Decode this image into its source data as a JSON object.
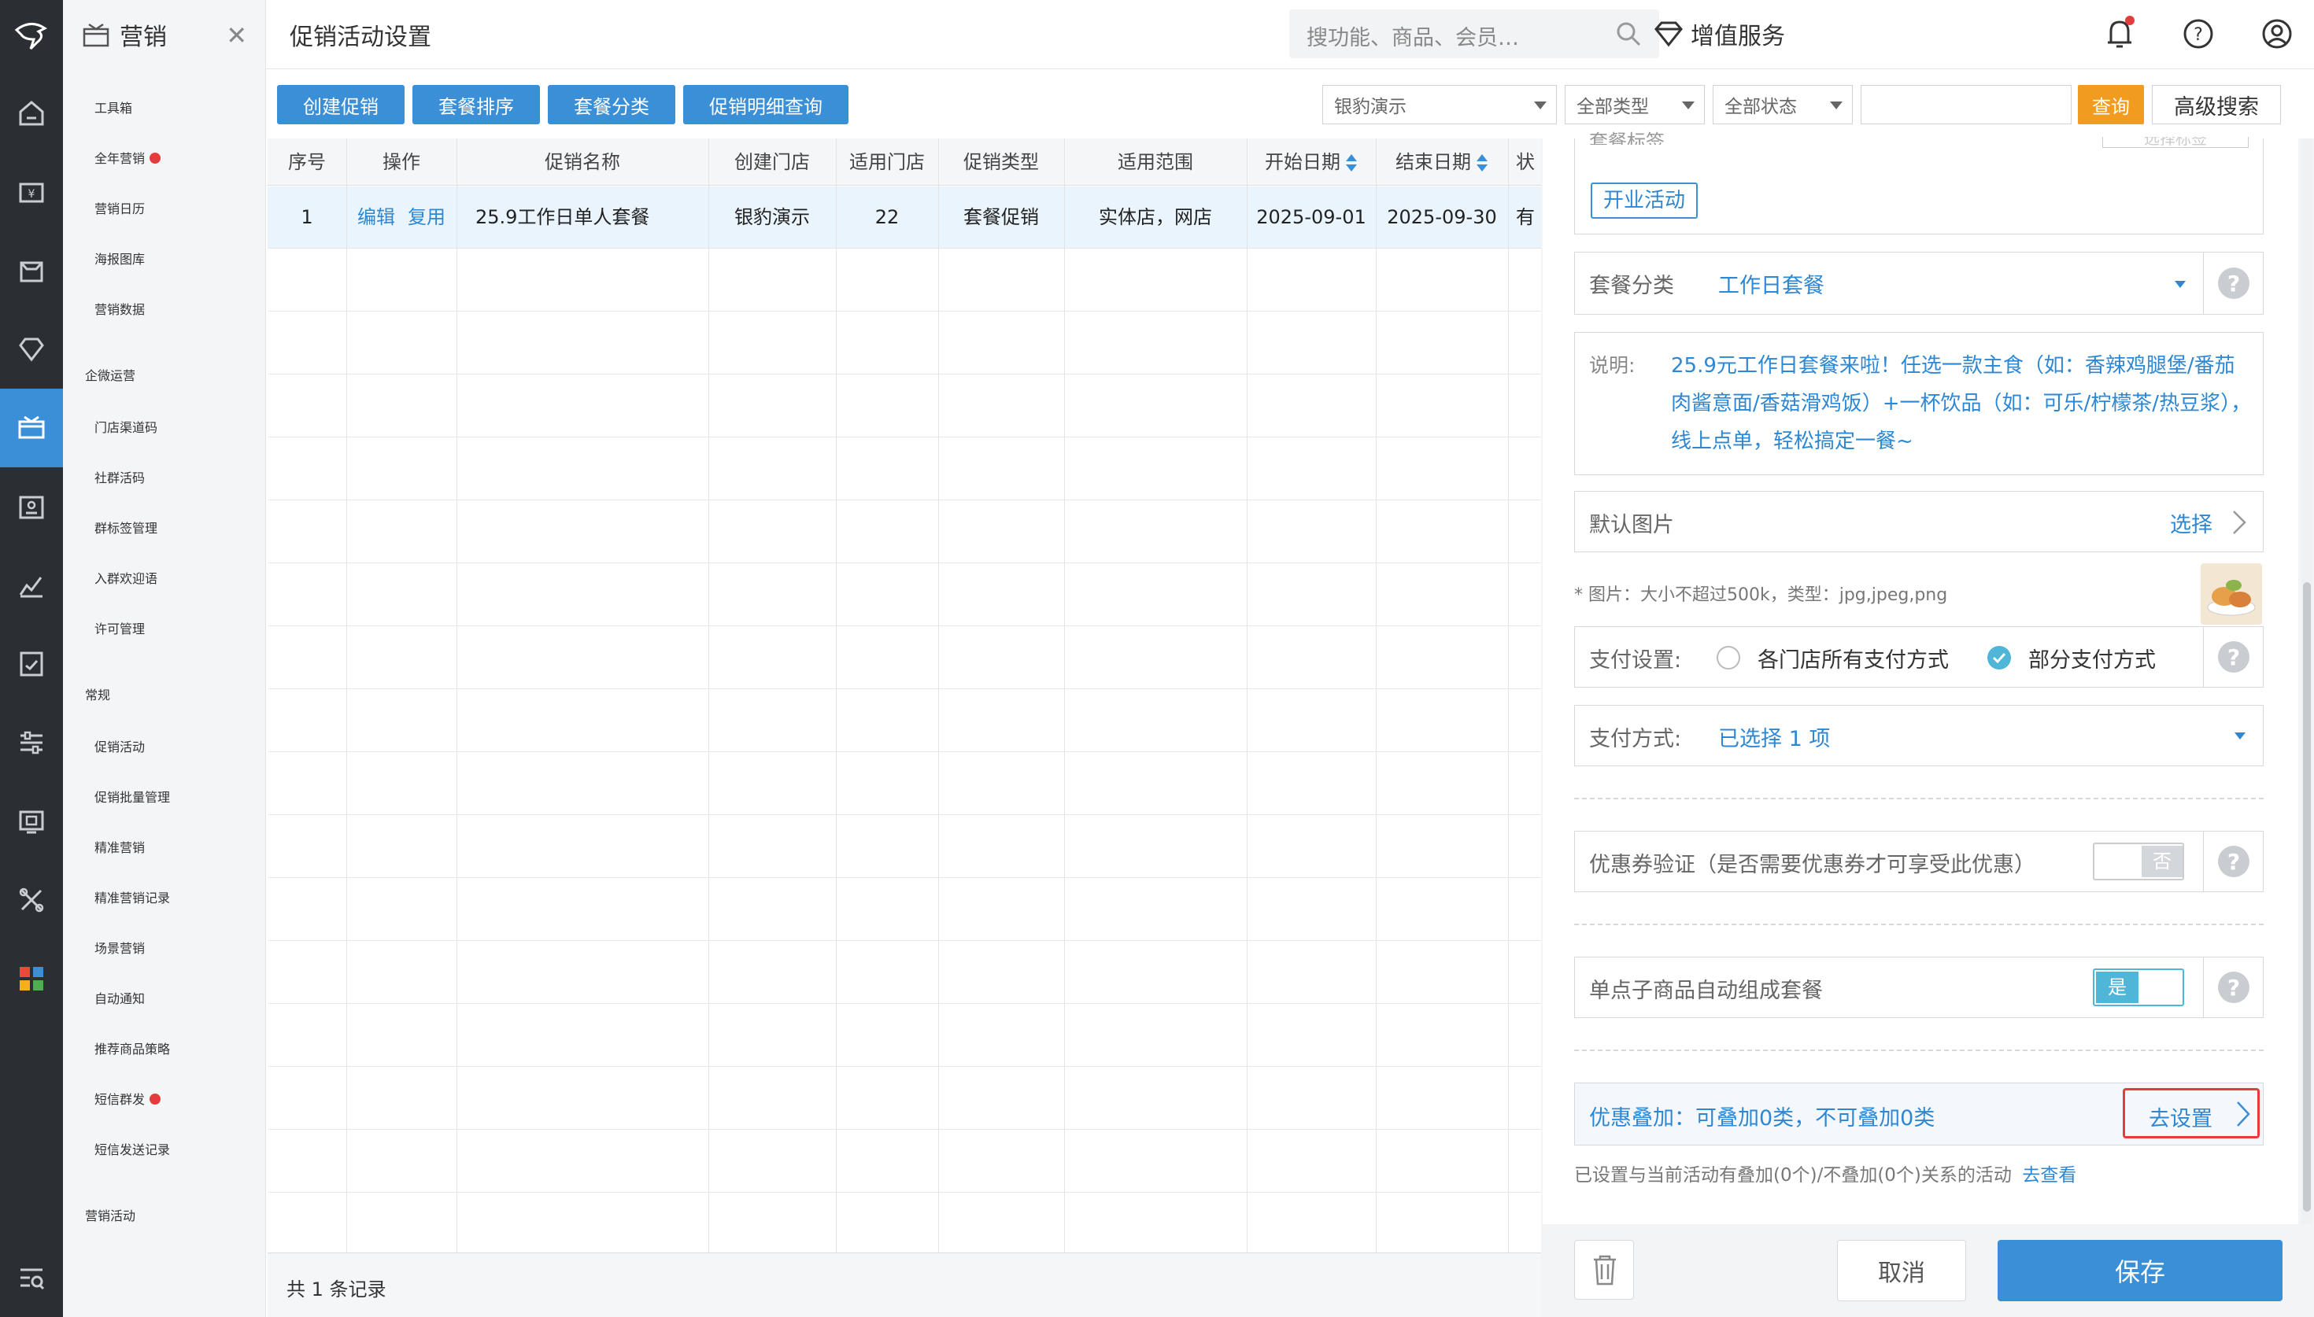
{
  "header": {
    "title": "促销活动设置",
    "search_placeholder": "搜功能、商品、会员…",
    "value_service": "增值服务"
  },
  "sidebar": {
    "title": "营销",
    "group1": [
      "工具箱",
      "全年营销",
      "营销日历",
      "海报图库",
      "营销数据"
    ],
    "section2": "企微运营",
    "group2": [
      "门店渠道码",
      "社群活码",
      "群标签管理",
      "入群欢迎语",
      "许可管理"
    ],
    "section3": "常规",
    "group3": [
      "促销活动",
      "促销批量管理",
      "精准营销",
      "精准营销记录",
      "场景营销",
      "自动通知",
      "推荐商品策略",
      "短信群发",
      "短信发送记录"
    ],
    "section4": "营销活动"
  },
  "toolbar": {
    "create": "创建促销",
    "sort": "套餐排序",
    "category": "套餐分类",
    "detail_query": "促销明细查询",
    "store_select": "银豹演示",
    "type_select": "全部类型",
    "status_select": "全部状态",
    "query": "查询",
    "advanced": "高级搜索"
  },
  "table": {
    "columns": [
      "序号",
      "操作",
      "促销名称",
      "创建门店",
      "适用门店",
      "促销类型",
      "适用范围",
      "开始日期",
      "结束日期",
      "状"
    ],
    "row": {
      "index": "1",
      "edit": "编辑",
      "copy": "复用",
      "name": "25.9工作日单人套餐",
      "store": "银豹演示",
      "stores_count": "22",
      "type": "套餐促销",
      "scope": "实体店，网店",
      "start": "2025-09-01",
      "end": "2025-09-30",
      "status": "有"
    },
    "footer": "共 1 条记录"
  },
  "panel": {
    "cut_label": "套餐标签",
    "cut_button": "选择标签",
    "tag": "开业活动",
    "package_category_label": "套餐分类",
    "package_category_value": "工作日套餐",
    "desc_label": "说明:",
    "desc_text": "25.9元工作日套餐来啦！任选一款主食（如：香辣鸡腿堡/番茄肉酱意面/香菇滑鸡饭）+一杯饮品（如：可乐/柠檬茶/热豆浆），线上点单，轻松搞定一餐~",
    "default_image_label": "默认图片",
    "choose": "选择",
    "image_note": "* 图片：大小不超过500k，类型：jpg,jpeg,png",
    "pay_setting_label": "支付设置:",
    "pay_opt_all": "各门店所有支付方式",
    "pay_opt_part": "部分支付方式",
    "pay_method_label": "支付方式:",
    "pay_method_value": "已选择 1 项",
    "coupon_label": "优惠券验证（是否需要优惠券才可享受此优惠）",
    "coupon_toggle": "否",
    "auto_combo_label": "单点子商品自动组成套餐",
    "auto_combo_toggle": "是",
    "stack_label": "优惠叠加：可叠加0类，不可叠加0类",
    "stack_action": "去设置",
    "stack_note": "已设置与当前活动有叠加(0个)/不叠加(0个)关系的活动",
    "stack_note_link": "去查看",
    "cancel": "取消",
    "save": "保存"
  },
  "colors": {
    "primary": "#3b8fd6",
    "rail": "#2b2e33",
    "query": "#f29c1f",
    "highlight": "#e53b3b"
  }
}
